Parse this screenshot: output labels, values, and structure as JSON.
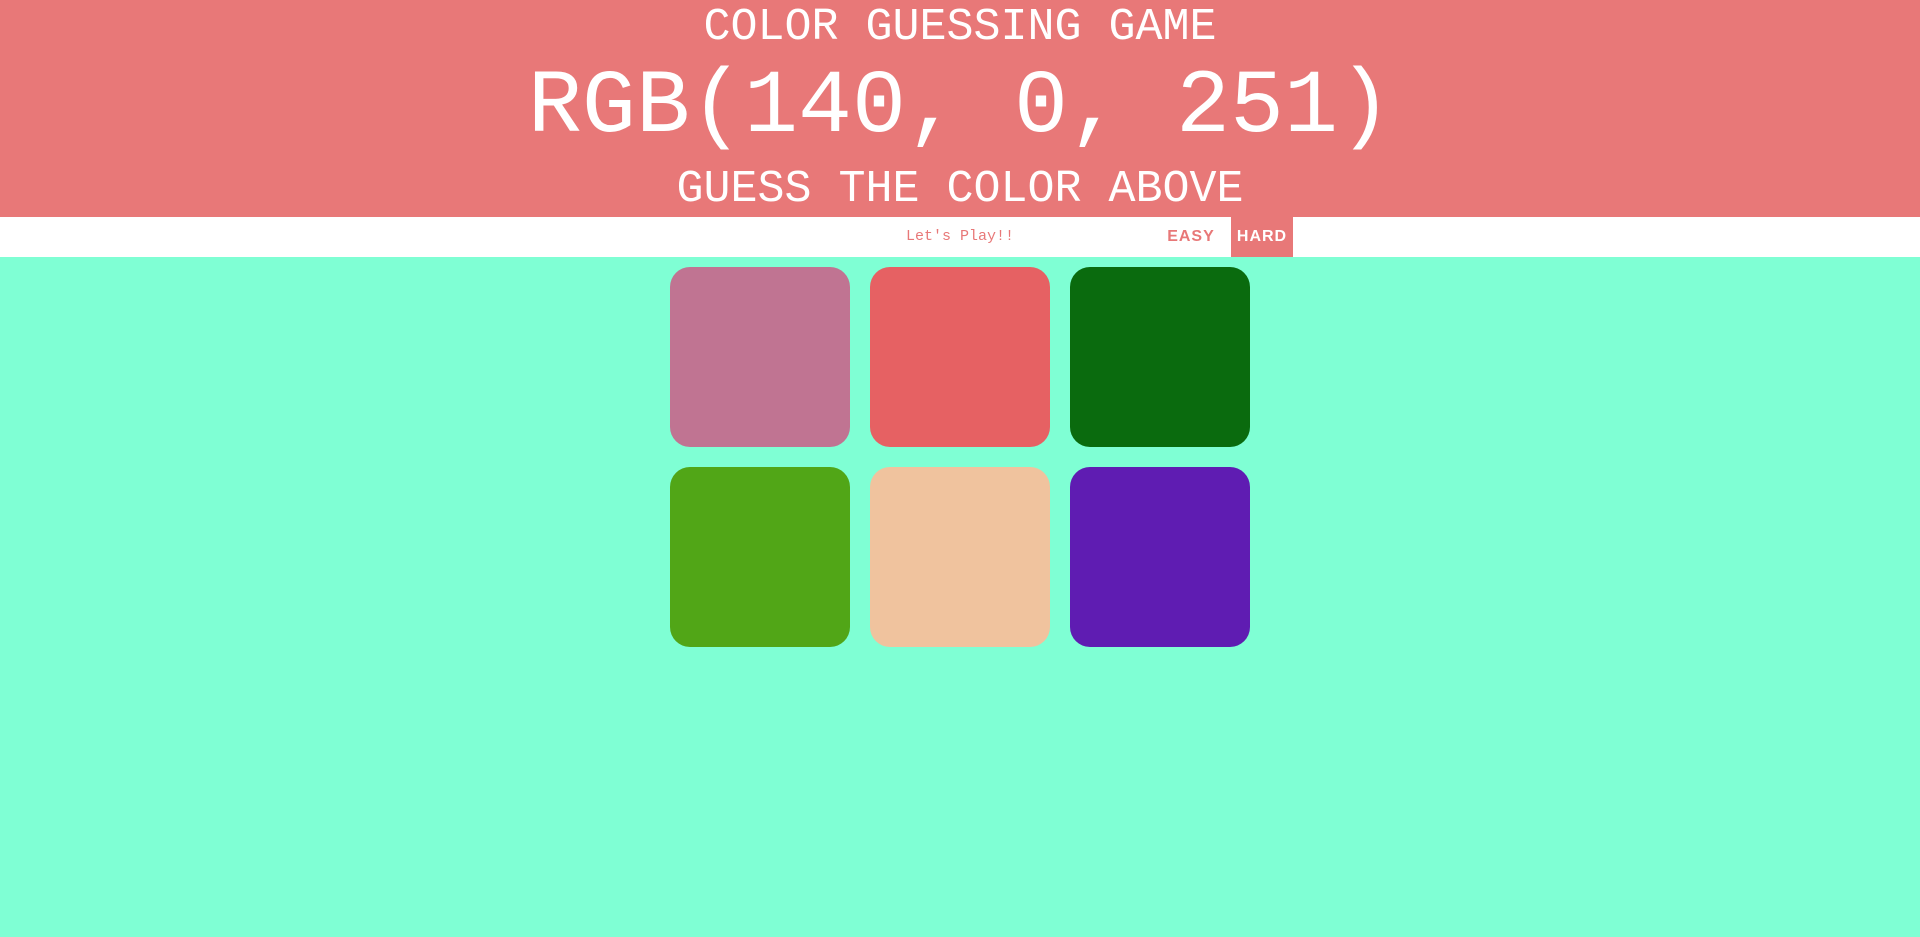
{
  "header": {
    "title": "COLOR GUESSING GAME",
    "rgb_display": "RGB(140, 0, 251)",
    "subtitle": "GUESS THE COLOR ABOVE",
    "background": "#e87878",
    "text_color": "#ffffff"
  },
  "controls": {
    "message": "Let's Play!!",
    "easy_label": "EASY",
    "hard_label": "HARD",
    "selected_mode": "HARD",
    "accent": "#e87878"
  },
  "page_background": "#7fffd4",
  "squares": [
    {
      "color": "#c07492"
    },
    {
      "color": "#e66163"
    },
    {
      "color": "#0a6b0e"
    },
    {
      "color": "#51a617"
    },
    {
      "color": "#f0c39e"
    },
    {
      "color": "#5f1cb2"
    }
  ]
}
